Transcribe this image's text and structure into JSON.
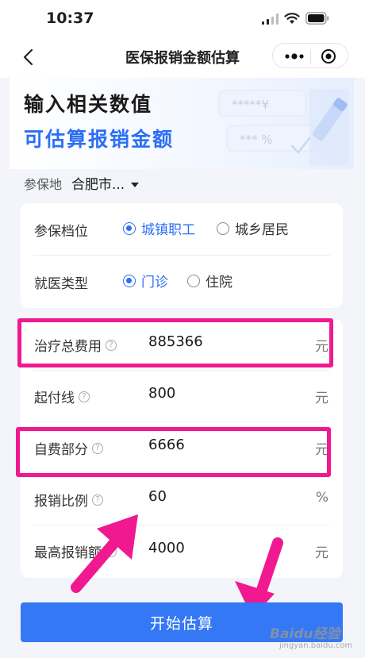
{
  "status_bar": {
    "time": "10:37"
  },
  "nav": {
    "title": "医保报销金额估算"
  },
  "banner": {
    "line1": "输入相关数值",
    "line2": "可估算报销金额",
    "deco_text1": "*****¥",
    "deco_text2": "*** %"
  },
  "location": {
    "label": "参保地",
    "value": "合肥市..."
  },
  "options": {
    "tier": {
      "label": "参保档位",
      "choices": [
        "城镇职工",
        "城乡居民"
      ],
      "selected": "城镇职工"
    },
    "visit": {
      "label": "就医类型",
      "choices": [
        "门诊",
        "住院"
      ],
      "selected": "门诊"
    }
  },
  "inputs": [
    {
      "label": "治疗总费用",
      "value": "885366",
      "unit": "元"
    },
    {
      "label": "起付线",
      "value": "800",
      "unit": "元"
    },
    {
      "label": "自费部分",
      "value": "6666",
      "unit": "元"
    },
    {
      "label": "报销比例",
      "value": "60",
      "unit": "%"
    },
    {
      "label": "最高报销额",
      "value": "4000",
      "unit": "元"
    }
  ],
  "button": {
    "label": "开始估算"
  },
  "watermark": {
    "brand": "Baidu经验",
    "url": "jingyan.baidu.com"
  },
  "colors": {
    "accent": "#2c6ff5",
    "button": "#3478f6",
    "highlight": "#f0198f"
  }
}
